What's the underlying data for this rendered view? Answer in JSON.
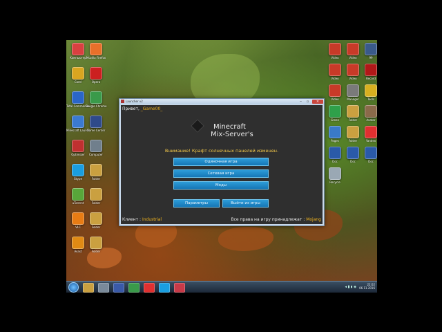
{
  "launcher": {
    "title": "Launcher v2",
    "greeting": "Привет, ",
    "username": "_Game00_",
    "brand_line1": "Minecraft",
    "brand_line2": "Mix-Server's",
    "warning": "Внимание! Крафт солнечных панелей изменен.",
    "buttons": {
      "singleplayer": "Одиночная игра",
      "multiplayer": "Сетевая игра",
      "mods": "Моды",
      "settings": "Параметры",
      "exit": "Выйти из игры"
    },
    "footer_client_label": "Клиент : ",
    "footer_client_value": "Industrial",
    "footer_rights": "Все права на игру принадлежат : ",
    "footer_owner": "Mojang"
  },
  "desktop_icons_left": [
    {
      "label": "Компьютер",
      "color": "#d94040",
      "icon": "computer-icon"
    },
    {
      "label": "Mozilla Firefox",
      "color": "#e8702a",
      "icon": "firefox-icon"
    },
    {
      "label": "Corel",
      "color": "#d9a520",
      "icon": "folder-icon"
    },
    {
      "label": "Opera",
      "color": "#cc2020",
      "icon": "opera-icon"
    },
    {
      "label": "Total Commander",
      "color": "#2a66c8",
      "icon": "totalcmd-icon"
    },
    {
      "label": "Google Chrome",
      "color": "#3a9a4a",
      "icon": "chrome-icon"
    },
    {
      "label": "Minecraft Launcher",
      "color": "#3b7ad1",
      "icon": "game-icon"
    },
    {
      "label": "Game Center",
      "color": "#2f4a8a",
      "icon": "game-center-icon"
    },
    {
      "label": "Optimizer",
      "color": "#c03030",
      "icon": "optimizer-icon"
    },
    {
      "label": "Computer",
      "color": "#707f8c",
      "icon": "pc-icon"
    },
    {
      "label": "Skype",
      "color": "#1a9ee0",
      "icon": "skype-icon"
    },
    {
      "label": "Folder",
      "color": "#caa040",
      "icon": "folder-icon"
    },
    {
      "label": "uTorrent",
      "color": "#58a73a",
      "icon": "utorrent-icon"
    },
    {
      "label": "Folder",
      "color": "#caa040",
      "icon": "folder-icon"
    },
    {
      "label": "VLC",
      "color": "#e87c14",
      "icon": "vlc-icon"
    },
    {
      "label": "Folder",
      "color": "#caa040",
      "icon": "folder-icon"
    },
    {
      "label": "Avast",
      "color": "#e08a14",
      "icon": "avast-icon"
    },
    {
      "label": "Folder",
      "color": "#caa040",
      "icon": "folder-icon"
    }
  ],
  "desktop_icons_right": [
    {
      "label": "Video",
      "color": "#c83a28",
      "icon": "app-icon"
    },
    {
      "label": "Video",
      "color": "#c83a28",
      "icon": "app-icon"
    },
    {
      "label": "99",
      "color": "#3a5a8a",
      "icon": "counter-icon"
    },
    {
      "label": "Video",
      "color": "#c83a28",
      "icon": "app-icon"
    },
    {
      "label": "Video",
      "color": "#c83a28",
      "icon": "app-icon"
    },
    {
      "label": "Record",
      "color": "#b01818",
      "icon": "record-icon"
    },
    {
      "label": "Video",
      "color": "#c83a28",
      "icon": "app-icon"
    },
    {
      "label": "Manager",
      "color": "#7a7a7a",
      "icon": "manager-icon"
    },
    {
      "label": "Tools",
      "color": "#d8b020",
      "icon": "tools-icon"
    },
    {
      "label": "Green",
      "color": "#2fa04a",
      "icon": "green-icon"
    },
    {
      "label": "Folder",
      "color": "#caa040",
      "icon": "folder-icon"
    },
    {
      "label": "Avatar",
      "color": "#8a6a4a",
      "icon": "avatar-icon"
    },
    {
      "label": "Pages",
      "color": "#3a7ac8",
      "icon": "pages-icon"
    },
    {
      "label": "Folder",
      "color": "#caa040",
      "icon": "folder-icon"
    },
    {
      "label": "Yandex",
      "color": "#e03030",
      "icon": "yandex-icon"
    },
    {
      "label": "Doc",
      "color": "#2a5aa8",
      "icon": "doc-icon"
    },
    {
      "label": "Doc",
      "color": "#2a5aa8",
      "icon": "doc-icon"
    },
    {
      "label": "Doc",
      "color": "#2a5aa8",
      "icon": "doc-icon"
    },
    {
      "label": "Recycle",
      "color": "#9aa8b4",
      "icon": "recycle-bin-icon"
    }
  ],
  "taskbar": {
    "apps": [
      {
        "name": "explorer-taskbar-button",
        "color": "#caa040"
      },
      {
        "name": "media-taskbar-button",
        "color": "#7a8a9a"
      },
      {
        "name": "save-taskbar-button",
        "color": "#3a5aa8"
      },
      {
        "name": "chrome-taskbar-button",
        "color": "#3a9a4a"
      },
      {
        "name": "yandex-taskbar-button",
        "color": "#e03030"
      },
      {
        "name": "skype-taskbar-button",
        "color": "#1a9ee0"
      },
      {
        "name": "launcher-taskbar-button",
        "color": "#c83a48"
      }
    ],
    "time": "22:02",
    "date": "06.11.2016"
  }
}
